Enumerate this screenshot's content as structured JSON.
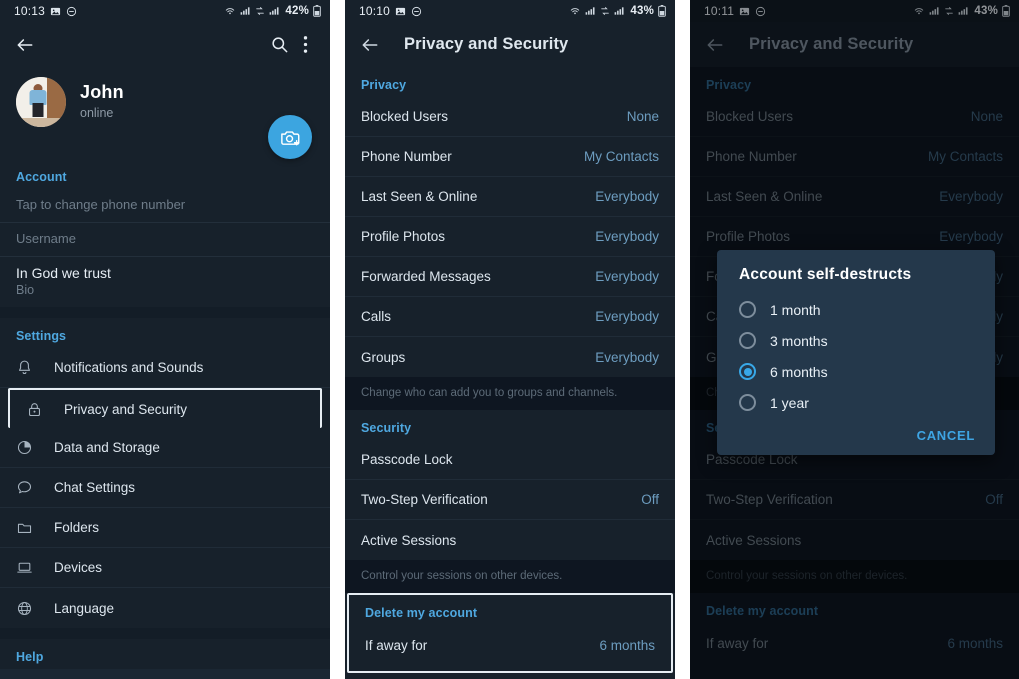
{
  "panels": [
    {
      "status_bar": {
        "time": "10:13",
        "battery": "42%",
        "icons": [
          "image-icon",
          "do-not-disturb-icon",
          "wifi-icon",
          "signal-icon",
          "sim-swap-icon",
          "signal2-icon",
          "battery-icon"
        ]
      },
      "appbar": {
        "back": "back-arrow-icon",
        "search": "search-icon",
        "menu": "overflow-menu-icon",
        "title": ""
      },
      "profile": {
        "name": "John",
        "status": "online",
        "camera_button": "camera-add-icon"
      },
      "account_section": {
        "header": "Account",
        "phone_hint": "Tap to change phone number",
        "username_placeholder": "Username",
        "bio_value": "In God we trust",
        "bio_label": "Bio"
      },
      "settings_section": {
        "header": "Settings",
        "items": [
          {
            "label": "Notifications and Sounds",
            "icon": "bell-icon",
            "selected": false
          },
          {
            "label": "Privacy and Security",
            "icon": "lock-icon",
            "selected": true
          },
          {
            "label": "Data and Storage",
            "icon": "pie-chart-icon",
            "selected": false
          },
          {
            "label": "Chat Settings",
            "icon": "chat-bubble-icon",
            "selected": false
          },
          {
            "label": "Folders",
            "icon": "folder-icon",
            "selected": false
          },
          {
            "label": "Devices",
            "icon": "laptop-icon",
            "selected": false
          },
          {
            "label": "Language",
            "icon": "globe-icon",
            "selected": false
          }
        ]
      },
      "help_section": {
        "header": "Help"
      }
    },
    {
      "status_bar": {
        "time": "10:10",
        "battery": "43%"
      },
      "appbar": {
        "title": "Privacy and Security",
        "back": "back-arrow-icon"
      },
      "privacy_section": {
        "header": "Privacy",
        "rows": [
          {
            "label": "Blocked Users",
            "value": "None"
          },
          {
            "label": "Phone Number",
            "value": "My Contacts"
          },
          {
            "label": "Last Seen & Online",
            "value": "Everybody"
          },
          {
            "label": "Profile Photos",
            "value": "Everybody"
          },
          {
            "label": "Forwarded Messages",
            "value": "Everybody"
          },
          {
            "label": "Calls",
            "value": "Everybody"
          },
          {
            "label": "Groups",
            "value": "Everybody"
          }
        ],
        "hint": "Change who can add you to groups and channels."
      },
      "security_section": {
        "header": "Security",
        "rows": [
          {
            "label": "Passcode Lock",
            "value": ""
          },
          {
            "label": "Two-Step Verification",
            "value": "Off"
          },
          {
            "label": "Active Sessions",
            "value": ""
          }
        ],
        "hint": "Control your sessions on other devices."
      },
      "delete_section": {
        "header": "Delete my account",
        "row": {
          "label": "If away for",
          "value": "6 months"
        },
        "highlighted": true
      }
    },
    {
      "status_bar": {
        "time": "10:11",
        "battery": "43%"
      },
      "appbar": {
        "title": "Privacy and Security",
        "back": "back-arrow-icon"
      },
      "dialog": {
        "title": "Account self-destructs",
        "options": [
          {
            "label": "1 month",
            "selected": false
          },
          {
            "label": "3 months",
            "selected": false
          },
          {
            "label": "6 months",
            "selected": true
          },
          {
            "label": "1 year",
            "selected": false
          }
        ],
        "cancel": "CANCEL"
      }
    }
  ],
  "colors": {
    "accent": "#3ca5e0",
    "panel_bg": "#17212b",
    "dialog_bg": "#24384b",
    "section_header": "#4fa8e0",
    "value_text": "#6d9dc0",
    "highlight_border": "#e6edf3"
  }
}
